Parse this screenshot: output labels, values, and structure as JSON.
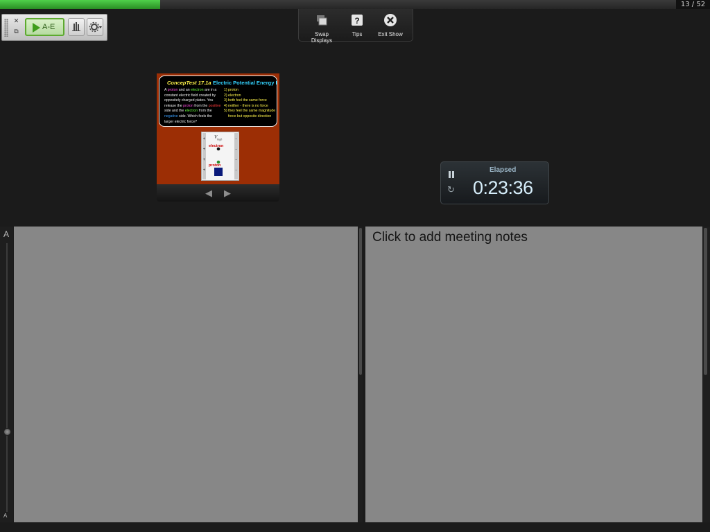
{
  "progress": {
    "fraction": 0.237,
    "counter": "13 / 52",
    "accent": "#3fbf35"
  },
  "clicker": {
    "answer_label": "A-E"
  },
  "presenter": {
    "swap_label": "Swap Displays",
    "tips_label": "Tips",
    "exit_label": "Exit Show"
  },
  "slide": {
    "title": "ConcepTest 17.1a",
    "subtitle": "Electric Potential Energy I",
    "question_parts": [
      "A ",
      "proton",
      " and an ",
      "electron",
      " are in a constant electric field created by oppositely charged plates. You release the ",
      "proton",
      " from the ",
      "positive",
      " side and the ",
      "electron",
      " from the ",
      "negative",
      " side. Which feels the larger electric force?"
    ],
    "options": [
      "1)  proton",
      "2)  electron",
      "3)  both feel the same force",
      "4)  neither - there is no force",
      "5)  they feel the same magnitude force but opposite direction"
    ],
    "diagram_electron": "electron",
    "diagram_proton": "proton",
    "diagram_top_label": "V",
    "diagram_top_sub": "high"
  },
  "timer": {
    "title": "Elapsed",
    "value": "0:23:36"
  },
  "font_slider": {
    "top": "A",
    "bottom": "A",
    "level": 0.7
  },
  "notes": {
    "placeholder": "Click to add meeting notes"
  }
}
